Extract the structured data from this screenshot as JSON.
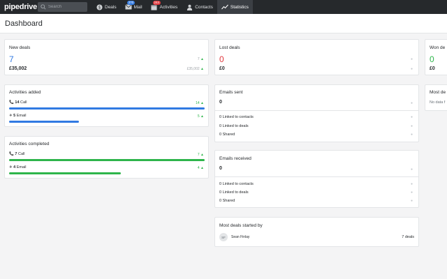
{
  "nav": {
    "logo": "pipedrive",
    "search_placeholder": "Search",
    "items": [
      {
        "label": "Deals",
        "icon": "dollar-icon"
      },
      {
        "label": "Mail",
        "icon": "mail-icon",
        "badge": "370"
      },
      {
        "label": "Activities",
        "icon": "calendar-icon",
        "badge": "244"
      },
      {
        "label": "Contacts",
        "icon": "person-icon"
      },
      {
        "label": "Statistics",
        "icon": "chart-icon",
        "active": true
      }
    ]
  },
  "page": {
    "title": "Dashboard"
  },
  "new_deals": {
    "title": "New deals",
    "count": "7",
    "count_change": "7",
    "amount": "£35,002",
    "amount_change": "£35,002"
  },
  "lost_deals": {
    "title": "Lost deals",
    "count": "0",
    "amount": "£0"
  },
  "won_deals": {
    "title": "Won de",
    "count": "0",
    "amount": "£0"
  },
  "activities_added": {
    "title": "Activities added",
    "rows": [
      {
        "count": "14",
        "label": "Call",
        "change": "14",
        "icon": "phone-icon",
        "progress": 1.0
      },
      {
        "count": "5",
        "label": "Email",
        "change": "5",
        "icon": "send-icon",
        "progress": 0.357
      }
    ]
  },
  "activities_completed": {
    "title": "Activities completed",
    "rows": [
      {
        "count": "7",
        "label": "Call",
        "change": "7",
        "icon": "phone-icon",
        "progress": 1.0
      },
      {
        "count": "4",
        "label": "Email",
        "change": "4",
        "icon": "send-icon",
        "progress": 0.571
      }
    ]
  },
  "emails_sent": {
    "title": "Emails sent",
    "count": "0",
    "rows": [
      "0 Linked to contacts",
      "0 Linked to deals",
      "0 Shared"
    ]
  },
  "emails_received": {
    "title": "Emails received",
    "count": "0",
    "rows": [
      "0 Linked to contacts",
      "0 Linked to deals",
      "0 Shared"
    ]
  },
  "most_deals": {
    "title": "Most deals started by",
    "initials": "SF",
    "name": "Sean Finlay",
    "value": "7 deals"
  },
  "most_right": {
    "title": "Most de",
    "empty": "No data f"
  },
  "colors": {
    "accent_blue": "#317ae2",
    "green": "#2eb54b",
    "red": "#e0393e",
    "nav_bg": "#26292c"
  }
}
